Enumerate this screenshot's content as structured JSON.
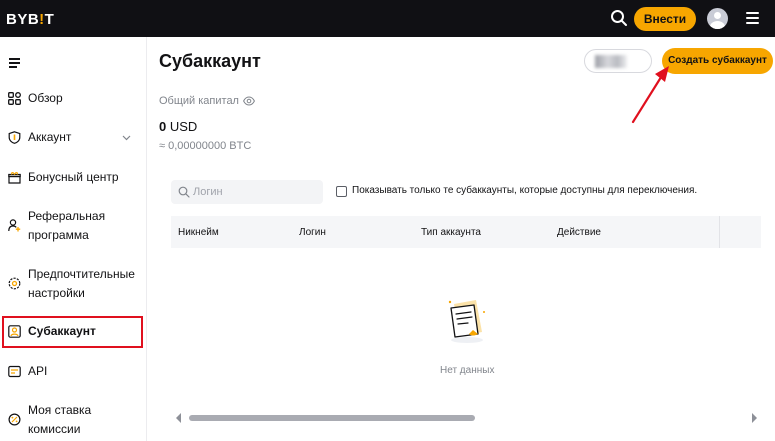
{
  "topbar": {
    "logo_prefix": "BYB",
    "logo_accent": "!",
    "logo_suffix": "T",
    "deposit_label": "Внести",
    "icons": [
      "search-icon",
      "avatar",
      "menu-icon"
    ]
  },
  "sidebar": {
    "items": [
      {
        "label": "Обзор",
        "icon": "grid-icon"
      },
      {
        "label": "Аккаунт",
        "icon": "shield-icon",
        "has_chevron": true
      },
      {
        "label": "Бонусный центр",
        "icon": "gift-icon"
      },
      {
        "label": "Реферальная",
        "label2": "программа",
        "icon": "referral-icon"
      },
      {
        "label": "Предпочтительные",
        "label2": "настройки",
        "icon": "settings-icon"
      },
      {
        "label": "Субаккаунт",
        "icon": "subaccount-icon",
        "active": true
      },
      {
        "label": "API",
        "icon": "api-icon"
      },
      {
        "label": "Моя ставка",
        "label2": "комиссии",
        "icon": "fee-icon"
      }
    ]
  },
  "main": {
    "title": "Субаккаунт",
    "create_button": "Создать субаккаунт",
    "capital_label": "Общий капитал",
    "capital_value": "0",
    "capital_currency": "USD",
    "capital_btc": "≈ 0,00000000 BTC",
    "search_placeholder": "Логин",
    "checkbox_label": "Показывать только те субаккаунты, которые доступны для переключения.",
    "table_headers": [
      "Никнейм",
      "Логин",
      "Тип аккаунта",
      "Действие"
    ],
    "empty_text": "Нет данных"
  },
  "colors": {
    "accent": "#f7a600",
    "topbar_bg": "#101014",
    "annotation_red": "#e0101e"
  }
}
